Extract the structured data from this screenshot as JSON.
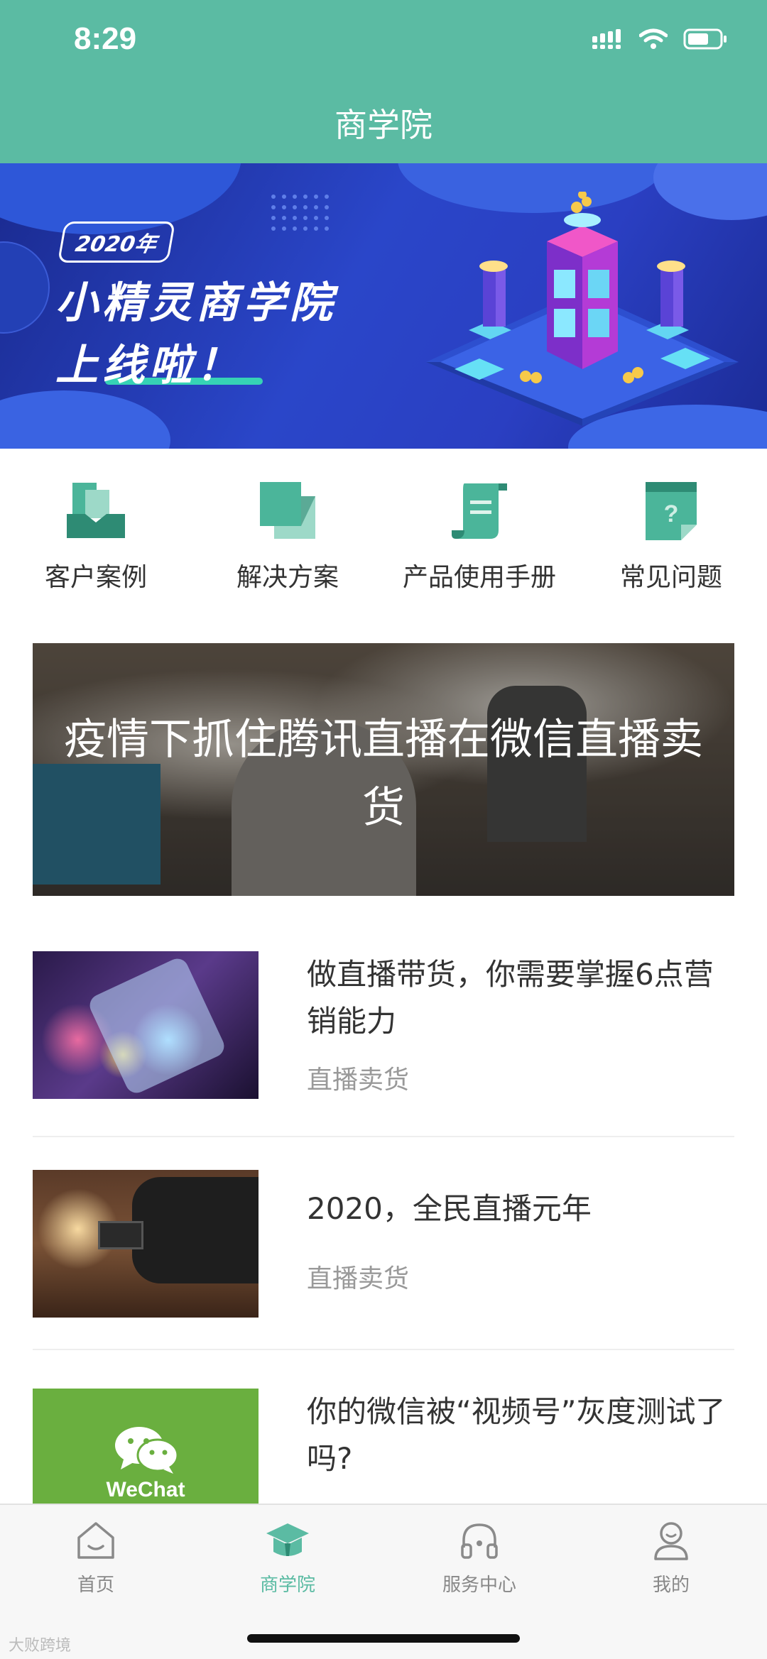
{
  "status_bar": {
    "time": "8:29"
  },
  "header": {
    "title": "商学院"
  },
  "banner": {
    "year_badge": "2020年",
    "line1": "小精灵商学院",
    "line2": "上线啦！"
  },
  "quick_menu": [
    {
      "label": "客户案例",
      "icon": "case-icon"
    },
    {
      "label": "解决方案",
      "icon": "solution-icon"
    },
    {
      "label": "产品使用手册",
      "icon": "manual-icon"
    },
    {
      "label": "常见问题",
      "icon": "faq-icon"
    }
  ],
  "feature": {
    "title": "疫情下抓住腾讯直播在微信直播卖货"
  },
  "articles": [
    {
      "title": "做直播带货，你需要掌握6点营销能力",
      "tag": "直播卖货"
    },
    {
      "title": "2020，全民直播元年",
      "tag": "直播卖货"
    },
    {
      "title": "你的微信被“视频号”灰度测试了吗?",
      "thumb_text": "WeChat"
    }
  ],
  "tabbar": [
    {
      "label": "首页",
      "icon": "home-icon"
    },
    {
      "label": "商学院",
      "icon": "graduation-cap-icon",
      "active": true
    },
    {
      "label": "服务中心",
      "icon": "headphones-icon"
    },
    {
      "label": "我的",
      "icon": "user-icon"
    }
  ],
  "watermark": "大败跨境",
  "colors": {
    "brand": "#5bbba3",
    "banner_bg": "#2a46c9",
    "wechat_green": "#6aaf3f"
  }
}
